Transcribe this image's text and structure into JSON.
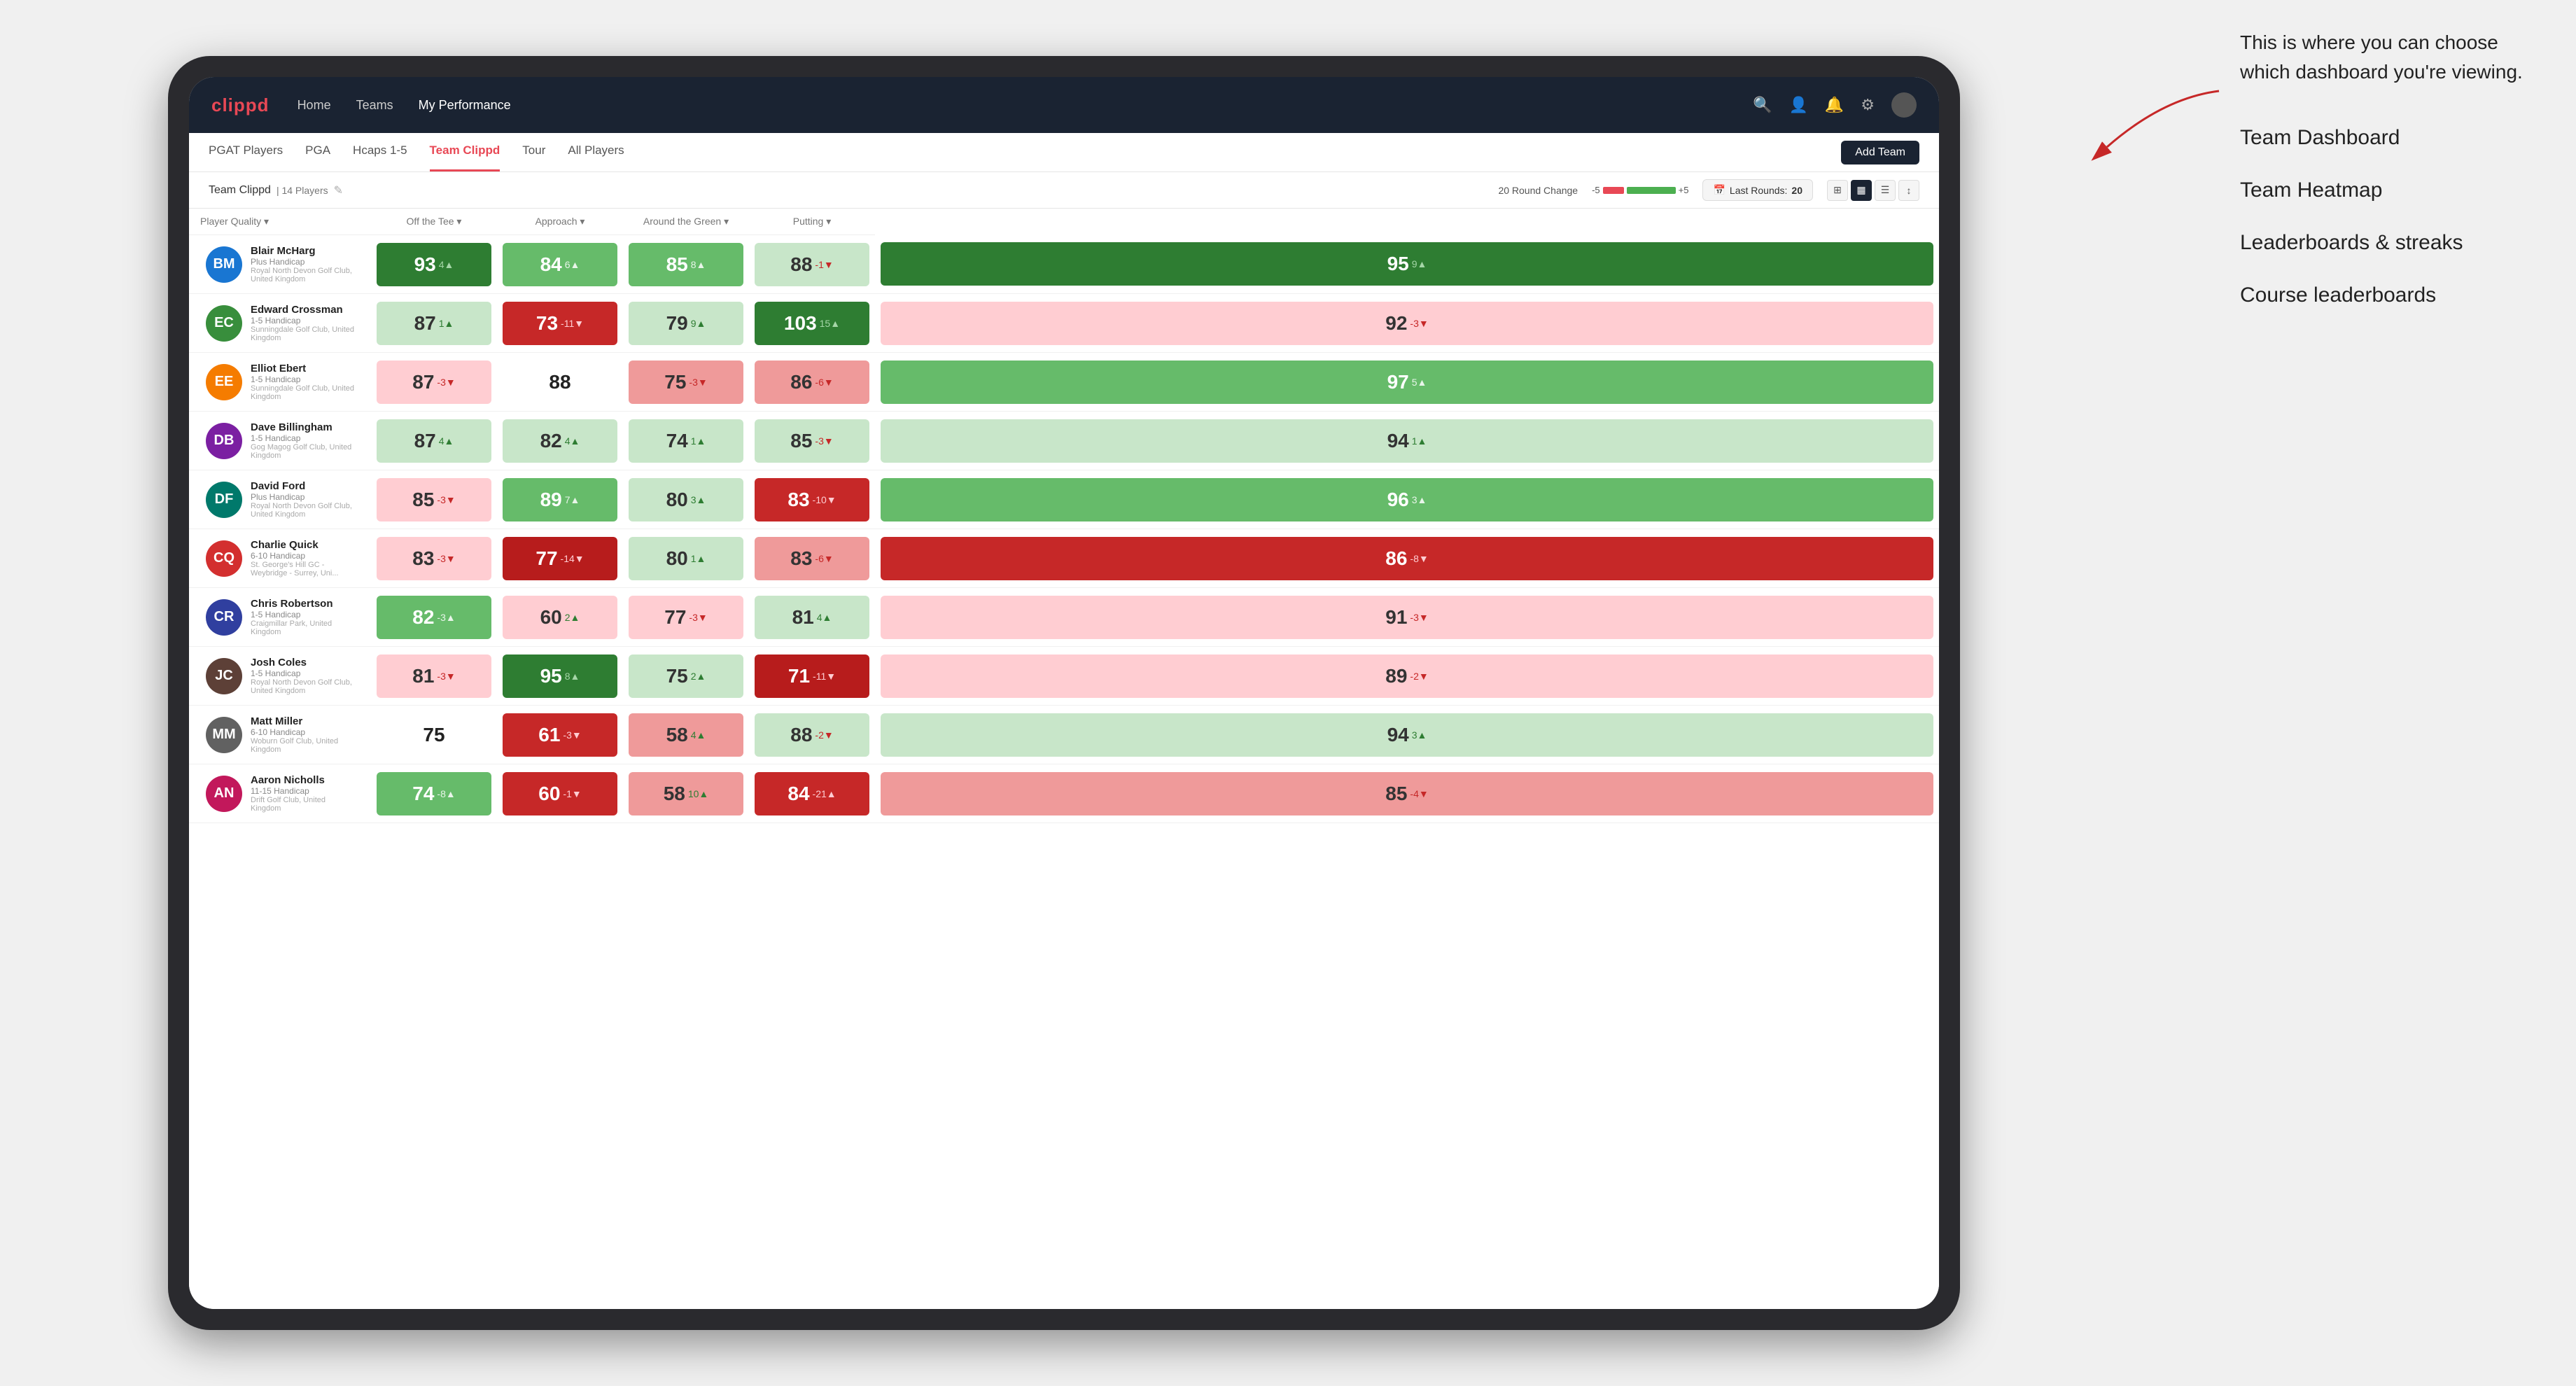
{
  "annotation": {
    "intro": "This is where you can choose which dashboard you're viewing.",
    "items": [
      "Team Dashboard",
      "Team Heatmap",
      "Leaderboards & streaks",
      "Course leaderboards"
    ]
  },
  "navbar": {
    "logo": "clippd",
    "nav_items": [
      "Home",
      "Teams",
      "My Performance"
    ],
    "active_nav": "My Performance"
  },
  "subnav": {
    "tabs": [
      "PGAT Players",
      "PGA",
      "Hcaps 1-5",
      "Team Clippd",
      "Tour",
      "All Players"
    ],
    "active_tab": "Team Clippd",
    "add_button": "Add Team"
  },
  "team_bar": {
    "name": "Team Clippd",
    "separator": "|",
    "count": "14 Players",
    "round_change_label": "20 Round Change",
    "round_change_minus": "-5",
    "round_change_plus": "+5",
    "last_rounds_label": "Last Rounds:",
    "last_rounds_value": "20"
  },
  "table": {
    "columns": [
      "Player Quality ▾",
      "Off the Tee ▾",
      "Approach ▾",
      "Around the Green ▾",
      "Putting ▾"
    ],
    "players": [
      {
        "name": "Blair McHarg",
        "hcap": "Plus Handicap",
        "club": "Royal North Devon Golf Club, United Kingdom",
        "initials": "BM",
        "av_color": "av-blue",
        "metrics": [
          {
            "value": "93",
            "change": "4▲",
            "color": "heat-strong-green"
          },
          {
            "value": "84",
            "change": "6▲",
            "color": "heat-medium-green"
          },
          {
            "value": "85",
            "change": "8▲",
            "color": "heat-medium-green"
          },
          {
            "value": "88",
            "change": "-1▼",
            "color": "heat-light-green"
          },
          {
            "value": "95",
            "change": "9▲",
            "color": "heat-strong-green"
          }
        ]
      },
      {
        "name": "Edward Crossman",
        "hcap": "1-5 Handicap",
        "club": "Sunningdale Golf Club, United Kingdom",
        "initials": "EC",
        "av_color": "av-green",
        "metrics": [
          {
            "value": "87",
            "change": "1▲",
            "color": "heat-light-green"
          },
          {
            "value": "73",
            "change": "-11▼",
            "color": "heat-strong-red"
          },
          {
            "value": "79",
            "change": "9▲",
            "color": "heat-light-green"
          },
          {
            "value": "103",
            "change": "15▲",
            "color": "heat-strong-green"
          },
          {
            "value": "92",
            "change": "-3▼",
            "color": "heat-light-red"
          }
        ]
      },
      {
        "name": "Elliot Ebert",
        "hcap": "1-5 Handicap",
        "club": "Sunningdale Golf Club, United Kingdom",
        "initials": "EE",
        "av_color": "av-orange",
        "metrics": [
          {
            "value": "87",
            "change": "-3▼",
            "color": "heat-light-red"
          },
          {
            "value": "88",
            "change": "",
            "color": "heat-white"
          },
          {
            "value": "75",
            "change": "-3▼",
            "color": "heat-medium-red"
          },
          {
            "value": "86",
            "change": "-6▼",
            "color": "heat-medium-red"
          },
          {
            "value": "97",
            "change": "5▲",
            "color": "heat-medium-green"
          }
        ]
      },
      {
        "name": "Dave Billingham",
        "hcap": "1-5 Handicap",
        "club": "Gog Magog Golf Club, United Kingdom",
        "initials": "DB",
        "av_color": "av-purple",
        "metrics": [
          {
            "value": "87",
            "change": "4▲",
            "color": "heat-light-green"
          },
          {
            "value": "82",
            "change": "4▲",
            "color": "heat-light-green"
          },
          {
            "value": "74",
            "change": "1▲",
            "color": "heat-light-green"
          },
          {
            "value": "85",
            "change": "-3▼",
            "color": "heat-light-green"
          },
          {
            "value": "94",
            "change": "1▲",
            "color": "heat-light-green"
          }
        ]
      },
      {
        "name": "David Ford",
        "hcap": "Plus Handicap",
        "club": "Royal North Devon Golf Club, United Kingdom",
        "initials": "DF",
        "av_color": "av-teal",
        "metrics": [
          {
            "value": "85",
            "change": "-3▼",
            "color": "heat-light-red"
          },
          {
            "value": "89",
            "change": "7▲",
            "color": "heat-medium-green"
          },
          {
            "value": "80",
            "change": "3▲",
            "color": "heat-light-green"
          },
          {
            "value": "83",
            "change": "-10▼",
            "color": "heat-strong-red"
          },
          {
            "value": "96",
            "change": "3▲",
            "color": "heat-medium-green"
          }
        ]
      },
      {
        "name": "Charlie Quick",
        "hcap": "6-10 Handicap",
        "club": "St. George's Hill GC - Weybridge - Surrey, Uni...",
        "initials": "CQ",
        "av_color": "av-red",
        "metrics": [
          {
            "value": "83",
            "change": "-3▼",
            "color": "heat-light-red"
          },
          {
            "value": "77",
            "change": "-14▼",
            "color": "heat-dark-red"
          },
          {
            "value": "80",
            "change": "1▲",
            "color": "heat-light-green"
          },
          {
            "value": "83",
            "change": "-6▼",
            "color": "heat-medium-red"
          },
          {
            "value": "86",
            "change": "-8▼",
            "color": "heat-strong-red"
          }
        ]
      },
      {
        "name": "Chris Robertson",
        "hcap": "1-5 Handicap",
        "club": "Craigmillar Park, United Kingdom",
        "initials": "CR",
        "av_color": "av-indigo",
        "metrics": [
          {
            "value": "82",
            "change": "-3▲",
            "color": "heat-medium-green"
          },
          {
            "value": "60",
            "change": "2▲",
            "color": "heat-light-red"
          },
          {
            "value": "77",
            "change": "-3▼",
            "color": "heat-light-red"
          },
          {
            "value": "81",
            "change": "4▲",
            "color": "heat-light-green"
          },
          {
            "value": "91",
            "change": "-3▼",
            "color": "heat-light-red"
          }
        ]
      },
      {
        "name": "Josh Coles",
        "hcap": "1-5 Handicap",
        "club": "Royal North Devon Golf Club, United Kingdom",
        "initials": "JC",
        "av_color": "av-brown",
        "metrics": [
          {
            "value": "81",
            "change": "-3▼",
            "color": "heat-light-red"
          },
          {
            "value": "95",
            "change": "8▲",
            "color": "heat-strong-green"
          },
          {
            "value": "75",
            "change": "2▲",
            "color": "heat-light-green"
          },
          {
            "value": "71",
            "change": "-11▼",
            "color": "heat-dark-red"
          },
          {
            "value": "89",
            "change": "-2▼",
            "color": "heat-light-red"
          }
        ]
      },
      {
        "name": "Matt Miller",
        "hcap": "6-10 Handicap",
        "club": "Woburn Golf Club, United Kingdom",
        "initials": "MM",
        "av_color": "av-grey",
        "metrics": [
          {
            "value": "75",
            "change": "",
            "color": "heat-white"
          },
          {
            "value": "61",
            "change": "-3▼",
            "color": "heat-strong-red"
          },
          {
            "value": "58",
            "change": "4▲",
            "color": "heat-medium-red"
          },
          {
            "value": "88",
            "change": "-2▼",
            "color": "heat-light-green"
          },
          {
            "value": "94",
            "change": "3▲",
            "color": "heat-light-green"
          }
        ]
      },
      {
        "name": "Aaron Nicholls",
        "hcap": "11-15 Handicap",
        "club": "Drift Golf Club, United Kingdom",
        "initials": "AN",
        "av_color": "av-pink",
        "metrics": [
          {
            "value": "74",
            "change": "-8▲",
            "color": "heat-medium-green"
          },
          {
            "value": "60",
            "change": "-1▼",
            "color": "heat-strong-red"
          },
          {
            "value": "58",
            "change": "10▲",
            "color": "heat-medium-red"
          },
          {
            "value": "84",
            "change": "-21▲",
            "color": "heat-strong-red"
          },
          {
            "value": "85",
            "change": "-4▼",
            "color": "heat-medium-red"
          }
        ]
      }
    ]
  }
}
